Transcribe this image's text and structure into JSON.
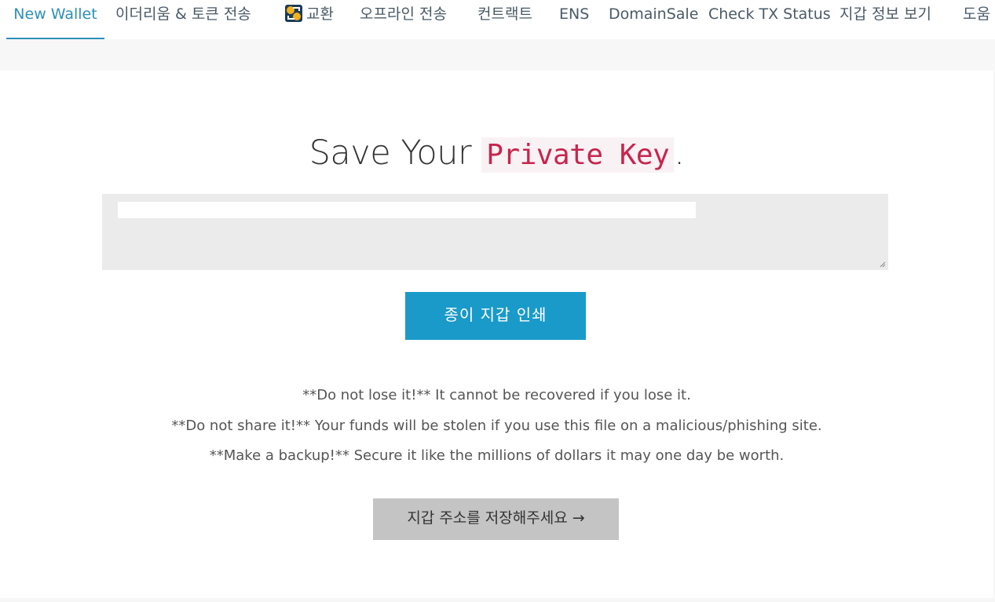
{
  "nav": {
    "items": [
      {
        "label": "New Wallet",
        "active": true
      },
      {
        "label": "이더리움 & 토큰 전송",
        "active": false
      },
      {
        "label": "교환",
        "active": false,
        "icon": "swap-icon"
      },
      {
        "label": "오프라인 전송",
        "active": false
      },
      {
        "label": "컨트랙트",
        "active": false
      },
      {
        "label": "ENS",
        "active": false
      },
      {
        "label": "DomainSale",
        "active": false
      },
      {
        "label": "Check TX Status",
        "active": false
      },
      {
        "label": "지갑 정보 보기",
        "active": false
      },
      {
        "label": "도움",
        "active": false
      }
    ]
  },
  "main": {
    "title_prefix": "Save Your",
    "title_code": "Private Key",
    "title_suffix": ".",
    "print_button": "종이 지갑 인쇄",
    "warnings": [
      "**Do not lose it!** It cannot be recovered if you lose it.",
      "**Do not share it!** Your funds will be stolen if you use this file on a malicious/phishing site.",
      "**Make a backup!** Secure it like the millions of dollars it may one day be worth."
    ],
    "next_button": "지갑 주소를 저장해주세요 →"
  },
  "colors": {
    "accent": "#2e8fb8",
    "print_button_bg": "#1a9ac9",
    "next_button_bg": "#c4c4c4",
    "code_text": "#c7254e",
    "code_bg": "#f9f2f4"
  }
}
